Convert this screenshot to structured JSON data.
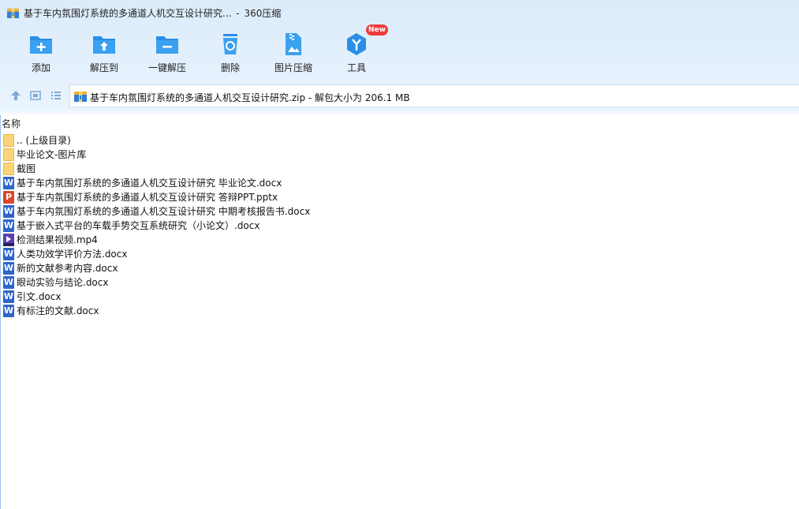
{
  "window": {
    "title": "基于车内氛围灯系统的多通道人机交互设计研究...",
    "app_name": "360压缩",
    "title_separator": "-"
  },
  "toolbar": {
    "items": [
      {
        "label": "添加",
        "icon": "add-icon"
      },
      {
        "label": "解压到",
        "icon": "extract-to-icon"
      },
      {
        "label": "一键解压",
        "icon": "one-click-extract-icon"
      },
      {
        "label": "删除",
        "icon": "delete-icon"
      },
      {
        "label": "图片压缩",
        "icon": "image-compress-icon"
      },
      {
        "label": "工具",
        "icon": "tools-icon",
        "badge": "New"
      }
    ]
  },
  "pathbar": {
    "path": "基于车内氛围灯系统的多通道人机交互设计研究.zip - 解包大小为 206.1 MB"
  },
  "list": {
    "column_name": "名称",
    "items": [
      {
        "name": ".. (上级目录)",
        "type": "folder"
      },
      {
        "name": "毕业论文-图片库",
        "type": "folder"
      },
      {
        "name": "截图",
        "type": "folder"
      },
      {
        "name": "基于车内氛围灯系统的多通道人机交互设计研究 毕业论文.docx",
        "type": "word",
        "glyph": "W"
      },
      {
        "name": "基于车内氛围灯系统的多通道人机交互设计研究 答辩PPT.pptx",
        "type": "ppt",
        "glyph": "P"
      },
      {
        "name": "基于车内氛围灯系统的多通道人机交互设计研究 中期考核报告书.docx",
        "type": "word",
        "glyph": "W"
      },
      {
        "name": "基于嵌入式平台的车载手势交互系统研究（小论文）.docx",
        "type": "word",
        "glyph": "W"
      },
      {
        "name": "检测结果视频.mp4",
        "type": "video"
      },
      {
        "name": "人类功效学评价方法.docx",
        "type": "word",
        "glyph": "W"
      },
      {
        "name": "新的文献参考内容.docx",
        "type": "word",
        "glyph": "W"
      },
      {
        "name": "眼动实验与结论.docx",
        "type": "word",
        "glyph": "W"
      },
      {
        "name": "引文.docx",
        "type": "word",
        "glyph": "W"
      },
      {
        "name": "有标注的文献.docx",
        "type": "word",
        "glyph": "W"
      }
    ]
  },
  "colors": {
    "toolbar_icon": "#2a8ee6",
    "badge": "#ef3b3b",
    "word": "#2f64c9",
    "ppt": "#d9482b",
    "folder": "#fbd577"
  }
}
